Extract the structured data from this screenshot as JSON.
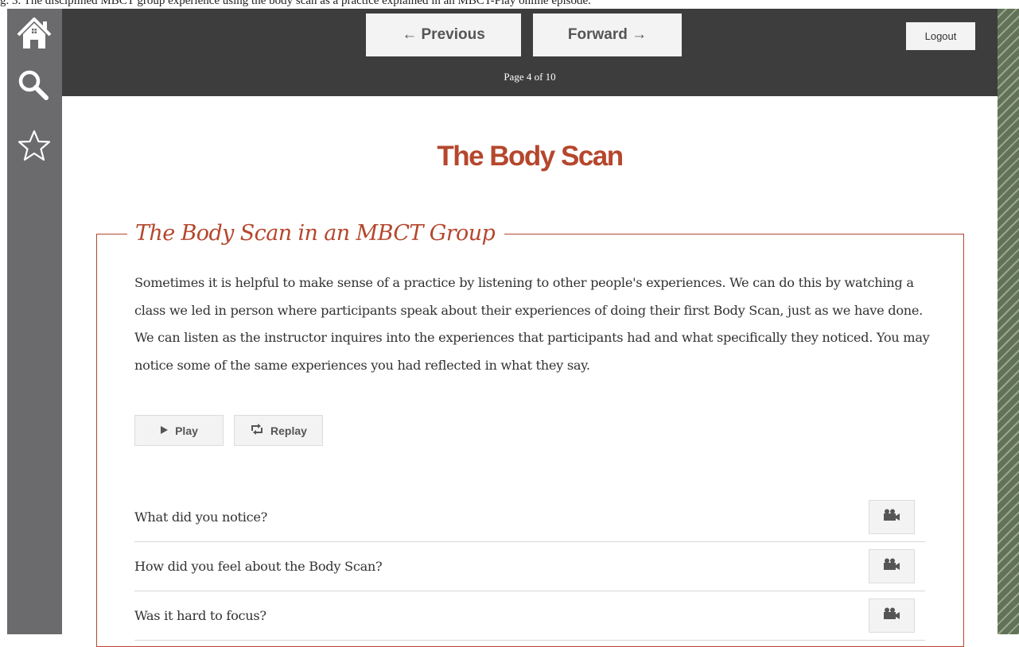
{
  "top_text": "g. 3. The disciplined MBCT group experience using the body scan as a practice explained in an MBCT-Play online episode.",
  "sidebar": {
    "home_icon": "home-icon",
    "search_icon": "search-icon",
    "favorites_icon": "star-icon"
  },
  "header": {
    "previous_label": "← Previous",
    "forward_label": "Forward →",
    "page_indicator": "Page 4 of 10",
    "logout_label": "Logout"
  },
  "page": {
    "title": "The Body Scan"
  },
  "section": {
    "heading": "The Body Scan in an MBCT Group",
    "body": "Sometimes it is helpful to make sense of a practice by listening to other people's experiences. We can do this by watching a class we led in person where participants speak about their experiences of doing their first Body Scan, just as we have done. We can listen as the instructor inquires into the experiences that participants had and what specifically they noticed. You may notice some of the same experiences you had reflected in what they say.",
    "play_label": "Play",
    "replay_label": "Replay",
    "play_icon": "play-icon",
    "replay_icon": "replay-icon",
    "questions": [
      {
        "text": "What did you notice?",
        "icon": "video-camera-icon"
      },
      {
        "text": "How did you feel about the Body Scan?",
        "icon": "video-camera-icon"
      },
      {
        "text": "Was it hard to focus?",
        "icon": "video-camera-icon"
      }
    ]
  },
  "colors": {
    "accent": "#b5472d",
    "sidebar": "#6b6b6e",
    "topbar": "#3d3d3d",
    "button_bg": "#f3f3f3",
    "stripe": "#627258"
  }
}
